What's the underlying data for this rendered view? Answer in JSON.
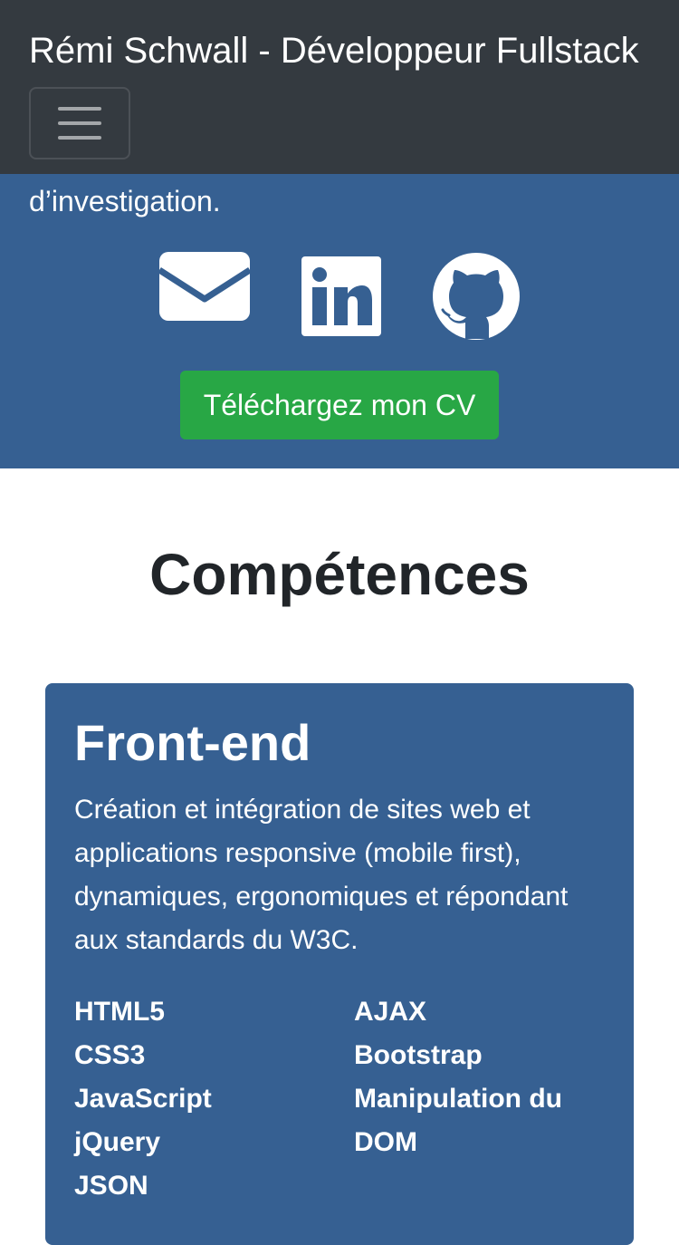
{
  "navbar": {
    "brand": "Rémi Schwall - Développeur Fullstack",
    "toggler_icon": "hamburger-menu-icon"
  },
  "hero": {
    "text_fragment": "d’investigation.",
    "social": [
      {
        "icon": "envelope-icon",
        "label": "email"
      },
      {
        "icon": "linkedin-icon",
        "label": "linkedin"
      },
      {
        "icon": "github-icon",
        "label": "github"
      }
    ],
    "cv_button": "Téléchargez mon CV"
  },
  "skills_section": {
    "title": "Compétences",
    "cards": [
      {
        "title": "Front-end",
        "description": "Création et intégration de sites web et applications responsive (mobile first), dynamiques, ergonomiques et répondant aux standards du W3C.",
        "skills_left": [
          "HTML5",
          "CSS3",
          "JavaScript",
          "jQuery",
          "JSON"
        ],
        "skills_right": [
          "AJAX",
          "Bootstrap",
          "Manipulation du DOM"
        ]
      }
    ]
  },
  "colors": {
    "navbar_bg": "#343a40",
    "primary_blue": "#366092",
    "success_green": "#28a745",
    "white": "#ffffff"
  }
}
